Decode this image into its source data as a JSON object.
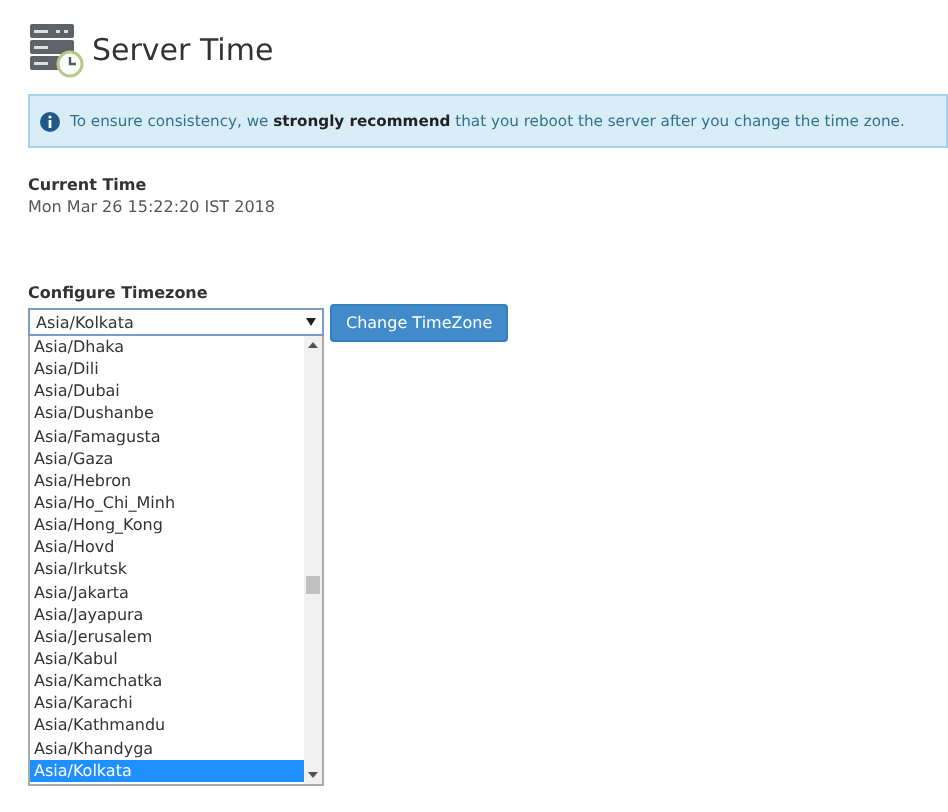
{
  "page": {
    "title": "Server Time"
  },
  "notice": {
    "text": "To ensure consistency, we **strongly recommend** that you reboot the server after you change the time zone."
  },
  "current_time": {
    "label": "Current Time",
    "value": "Mon Mar 26 15:22:20 IST 2018"
  },
  "timezone": {
    "label": "Configure Timezone",
    "value": "Asia/Kolkata",
    "button": "Change TimeZone",
    "options": [
      {
        "label": "Asia/Dhaka",
        "selected": false
      },
      {
        "label": "Asia/Dili",
        "selected": false
      },
      {
        "label": "Asia/Dubai",
        "selected": false
      },
      {
        "label": "Asia/Dushanbe",
        "selected": false
      },
      {
        "label": "Asia/Famagusta",
        "selected": false
      },
      {
        "label": "Asia/Gaza",
        "selected": false
      },
      {
        "label": "Asia/Hebron",
        "selected": false
      },
      {
        "label": "Asia/Ho_Chi_Minh",
        "selected": false
      },
      {
        "label": "Asia/Hong_Kong",
        "selected": false
      },
      {
        "label": "Asia/Hovd",
        "selected": false
      },
      {
        "label": "Asia/Irkutsk",
        "selected": false
      },
      {
        "label": "Asia/Jakarta",
        "selected": false
      },
      {
        "label": "Asia/Jayapura",
        "selected": false
      },
      {
        "label": "Asia/Jerusalem",
        "selected": false
      },
      {
        "label": "Asia/Kabul",
        "selected": false
      },
      {
        "label": "Asia/Kamchatka",
        "selected": false
      },
      {
        "label": "Asia/Karachi",
        "selected": false
      },
      {
        "label": "Asia/Kathmandu",
        "selected": false
      },
      {
        "label": "Asia/Khandyga",
        "selected": false
      },
      {
        "label": "Asia/Kolkata",
        "selected": true
      }
    ]
  }
}
